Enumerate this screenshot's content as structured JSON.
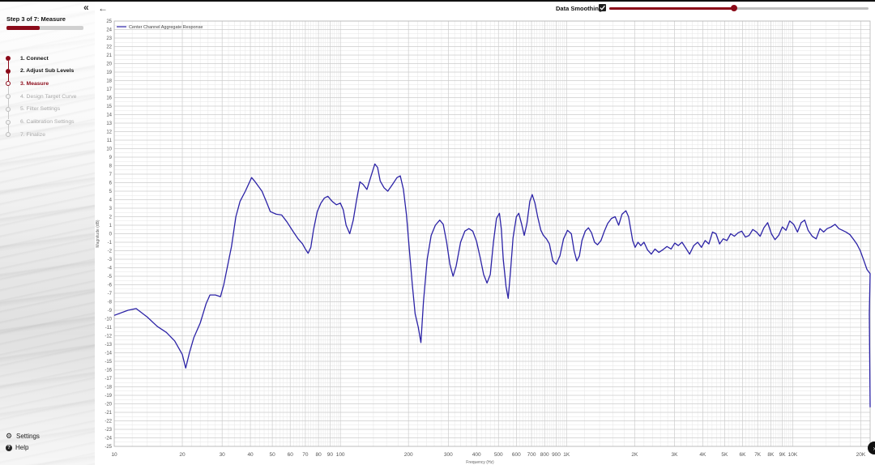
{
  "sidebar": {
    "collapse_icon": "«",
    "step_title": "Step 3 of 7: Measure",
    "progress": 0.43,
    "steps": [
      {
        "label": "1. Connect",
        "state": "done"
      },
      {
        "label": "2. Adjust Sub Levels",
        "state": "done"
      },
      {
        "label": "3. Measure",
        "state": "current"
      },
      {
        "label": "4. Design Target Curve",
        "state": "todo"
      },
      {
        "label": "5. Filter Settings",
        "state": "todo"
      },
      {
        "label": "6. Calibration Settings",
        "state": "todo"
      },
      {
        "label": "7. Finalize",
        "state": "todo"
      }
    ],
    "settings_label": "Settings",
    "help_label": "Help",
    "settings_icon": "gear-icon",
    "help_icon": "question-circle-icon"
  },
  "toolbar": {
    "back_icon": "←",
    "smoothing_label": "Data Smoothing",
    "smoothing_checked": true,
    "smoothing_level": 0.48
  },
  "colors": {
    "accent": "#8b0a19",
    "series": "#2b22a6",
    "grid_major": "#cccccc",
    "grid_minor": "#e6e6e6"
  },
  "chart_data": {
    "type": "line",
    "xscale": "log",
    "xlim": [
      10,
      22000
    ],
    "ylim": [
      -25,
      25
    ],
    "xlabel": "Frequency (Hz)",
    "ylabel": "Magnitude (dB)",
    "grid": true,
    "legend_position": "top-left",
    "x_ticks": [
      {
        "v": 10,
        "t": "10"
      },
      {
        "v": 20,
        "t": "20"
      },
      {
        "v": 30,
        "t": "30"
      },
      {
        "v": 40,
        "t": "40"
      },
      {
        "v": 50,
        "t": "50"
      },
      {
        "v": 60,
        "t": "60"
      },
      {
        "v": 70,
        "t": "70"
      },
      {
        "v": 80,
        "t": "80"
      },
      {
        "v": 90,
        "t": "90"
      },
      {
        "v": 100,
        "t": "100"
      },
      {
        "v": 200,
        "t": "200"
      },
      {
        "v": 300,
        "t": "300"
      },
      {
        "v": 400,
        "t": "400"
      },
      {
        "v": 500,
        "t": "500"
      },
      {
        "v": 600,
        "t": "600"
      },
      {
        "v": 700,
        "t": "700"
      },
      {
        "v": 800,
        "t": "800"
      },
      {
        "v": 900,
        "t": "900"
      },
      {
        "v": 1000,
        "t": "1K"
      },
      {
        "v": 2000,
        "t": "2K"
      },
      {
        "v": 3000,
        "t": "3K"
      },
      {
        "v": 4000,
        "t": "4K"
      },
      {
        "v": 5000,
        "t": "5K"
      },
      {
        "v": 6000,
        "t": "6K"
      },
      {
        "v": 7000,
        "t": "7K"
      },
      {
        "v": 8000,
        "t": "8K"
      },
      {
        "v": 9000,
        "t": "9K"
      },
      {
        "v": 10000,
        "t": "10K"
      },
      {
        "v": 20000,
        "t": "20K"
      }
    ],
    "series": [
      {
        "name": "Center Channel Aggregate Response",
        "points": [
          [
            10,
            -9.6
          ],
          [
            11.5,
            -9.0
          ],
          [
            12.5,
            -8.8
          ],
          [
            14,
            -9.8
          ],
          [
            15.5,
            -10.9
          ],
          [
            17,
            -11.6
          ],
          [
            18.5,
            -12.6
          ],
          [
            20,
            -14.2
          ],
          [
            20.7,
            -15.8
          ],
          [
            21.5,
            -14
          ],
          [
            22.5,
            -12.2
          ],
          [
            24,
            -10.5
          ],
          [
            25.5,
            -8.2
          ],
          [
            26.5,
            -7.2
          ],
          [
            28,
            -7.2
          ],
          [
            29.5,
            -7.4
          ],
          [
            30.5,
            -6.0
          ],
          [
            33,
            -1.5
          ],
          [
            34.5,
            2.0
          ],
          [
            36,
            3.8
          ],
          [
            38,
            5.0
          ],
          [
            40.5,
            6.6
          ],
          [
            42,
            6.1
          ],
          [
            45,
            5.0
          ],
          [
            47,
            3.8
          ],
          [
            49,
            2.6
          ],
          [
            52,
            2.3
          ],
          [
            55,
            2.2
          ],
          [
            58,
            1.4
          ],
          [
            62,
            0.2
          ],
          [
            65,
            -0.6
          ],
          [
            68,
            -1.2
          ],
          [
            70,
            -1.8
          ],
          [
            72,
            -2.3
          ],
          [
            74,
            -1.6
          ],
          [
            76,
            0.4
          ],
          [
            79,
            2.6
          ],
          [
            82,
            3.6
          ],
          [
            85,
            4.2
          ],
          [
            88,
            4.4
          ],
          [
            92,
            3.8
          ],
          [
            96,
            3.4
          ],
          [
            100,
            3.6
          ],
          [
            103,
            2.8
          ],
          [
            106,
            1.0
          ],
          [
            110,
            0.0
          ],
          [
            114,
            1.6
          ],
          [
            118,
            4.0
          ],
          [
            122,
            6.1
          ],
          [
            126,
            5.8
          ],
          [
            131,
            5.2
          ],
          [
            136,
            6.6
          ],
          [
            142,
            8.2
          ],
          [
            146,
            7.8
          ],
          [
            150,
            6.2
          ],
          [
            156,
            5.4
          ],
          [
            162,
            5.0
          ],
          [
            170,
            5.8
          ],
          [
            178,
            6.6
          ],
          [
            184,
            6.8
          ],
          [
            190,
            5.2
          ],
          [
            196,
            2.2
          ],
          [
            202,
            -2.0
          ],
          [
            208,
            -6.0
          ],
          [
            214,
            -9.4
          ],
          [
            221,
            -11.0
          ],
          [
            227,
            -12.8
          ],
          [
            233,
            -8.0
          ],
          [
            242,
            -3.0
          ],
          [
            252,
            -0.2
          ],
          [
            263,
            1.0
          ],
          [
            275,
            1.6
          ],
          [
            285,
            1.1
          ],
          [
            295,
            -1.0
          ],
          [
            305,
            -3.6
          ],
          [
            315,
            -5.0
          ],
          [
            325,
            -3.8
          ],
          [
            340,
            -1.0
          ],
          [
            355,
            0.3
          ],
          [
            370,
            0.6
          ],
          [
            385,
            0.3
          ],
          [
            400,
            -0.9
          ],
          [
            415,
            -2.8
          ],
          [
            430,
            -4.8
          ],
          [
            445,
            -5.8
          ],
          [
            460,
            -4.8
          ],
          [
            475,
            -1.0
          ],
          [
            490,
            1.8
          ],
          [
            505,
            2.4
          ],
          [
            515,
            0.5
          ],
          [
            525,
            -3.0
          ],
          [
            540,
            -6.2
          ],
          [
            552,
            -7.6
          ],
          [
            565,
            -4.5
          ],
          [
            580,
            -0.5
          ],
          [
            600,
            2.0
          ],
          [
            615,
            2.4
          ],
          [
            632,
            1.2
          ],
          [
            650,
            -0.2
          ],
          [
            668,
            1.2
          ],
          [
            688,
            3.8
          ],
          [
            705,
            4.6
          ],
          [
            725,
            3.6
          ],
          [
            745,
            2.0
          ],
          [
            770,
            0.4
          ],
          [
            790,
            -0.2
          ],
          [
            815,
            -0.6
          ],
          [
            840,
            -1.2
          ],
          [
            870,
            -3.2
          ],
          [
            900,
            -3.6
          ],
          [
            935,
            -2.6
          ],
          [
            970,
            -0.6
          ],
          [
            1010,
            0.4
          ],
          [
            1050,
            0.0
          ],
          [
            1080,
            -2.0
          ],
          [
            1110,
            -3.2
          ],
          [
            1140,
            -2.6
          ],
          [
            1170,
            -0.8
          ],
          [
            1210,
            0.3
          ],
          [
            1250,
            0.7
          ],
          [
            1290,
            0.1
          ],
          [
            1330,
            -1.0
          ],
          [
            1370,
            -1.3
          ],
          [
            1420,
            -0.8
          ],
          [
            1470,
            0.3
          ],
          [
            1520,
            1.2
          ],
          [
            1580,
            1.8
          ],
          [
            1640,
            2.0
          ],
          [
            1700,
            1.0
          ],
          [
            1760,
            2.3
          ],
          [
            1830,
            2.7
          ],
          [
            1880,
            2.0
          ],
          [
            1920,
            0.6
          ],
          [
            1960,
            -0.8
          ],
          [
            2010,
            -1.6
          ],
          [
            2070,
            -1.0
          ],
          [
            2130,
            -1.4
          ],
          [
            2200,
            -1.0
          ],
          [
            2280,
            -1.9
          ],
          [
            2370,
            -2.4
          ],
          [
            2460,
            -1.8
          ],
          [
            2560,
            -2.2
          ],
          [
            2660,
            -1.9
          ],
          [
            2780,
            -1.5
          ],
          [
            2900,
            -1.8
          ],
          [
            3010,
            -1.1
          ],
          [
            3120,
            -1.4
          ],
          [
            3240,
            -1.0
          ],
          [
            3370,
            -1.7
          ],
          [
            3500,
            -2.4
          ],
          [
            3650,
            -1.4
          ],
          [
            3800,
            -1.0
          ],
          [
            3950,
            -1.6
          ],
          [
            4100,
            -0.8
          ],
          [
            4260,
            -1.2
          ],
          [
            4420,
            0.2
          ],
          [
            4580,
            0.0
          ],
          [
            4750,
            -1.2
          ],
          [
            4930,
            -0.6
          ],
          [
            5120,
            -0.8
          ],
          [
            5320,
            0.0
          ],
          [
            5520,
            -0.3
          ],
          [
            5730,
            0.1
          ],
          [
            5950,
            0.3
          ],
          [
            6180,
            -0.4
          ],
          [
            6420,
            -0.2
          ],
          [
            6660,
            0.5
          ],
          [
            6920,
            0.2
          ],
          [
            7180,
            -0.3
          ],
          [
            7460,
            0.7
          ],
          [
            7750,
            1.3
          ],
          [
            8050,
            0.0
          ],
          [
            8350,
            -0.7
          ],
          [
            8670,
            -0.2
          ],
          [
            9000,
            0.8
          ],
          [
            9340,
            0.4
          ],
          [
            9700,
            1.5
          ],
          [
            10100,
            1.1
          ],
          [
            10500,
            0.2
          ],
          [
            10900,
            1.3
          ],
          [
            11300,
            1.6
          ],
          [
            11700,
            0.4
          ],
          [
            12200,
            -0.3
          ],
          [
            12700,
            -0.6
          ],
          [
            13200,
            0.6
          ],
          [
            13700,
            0.2
          ],
          [
            14200,
            0.6
          ],
          [
            14800,
            0.8
          ],
          [
            15400,
            1.1
          ],
          [
            16000,
            0.6
          ],
          [
            16600,
            0.4
          ],
          [
            17200,
            0.2
          ],
          [
            17900,
            -0.1
          ],
          [
            18500,
            -0.6
          ],
          [
            19200,
            -1.2
          ],
          [
            19900,
            -2.0
          ],
          [
            20600,
            -3.1
          ],
          [
            21300,
            -4.2
          ],
          [
            22000,
            -4.7
          ]
        ]
      }
    ]
  }
}
